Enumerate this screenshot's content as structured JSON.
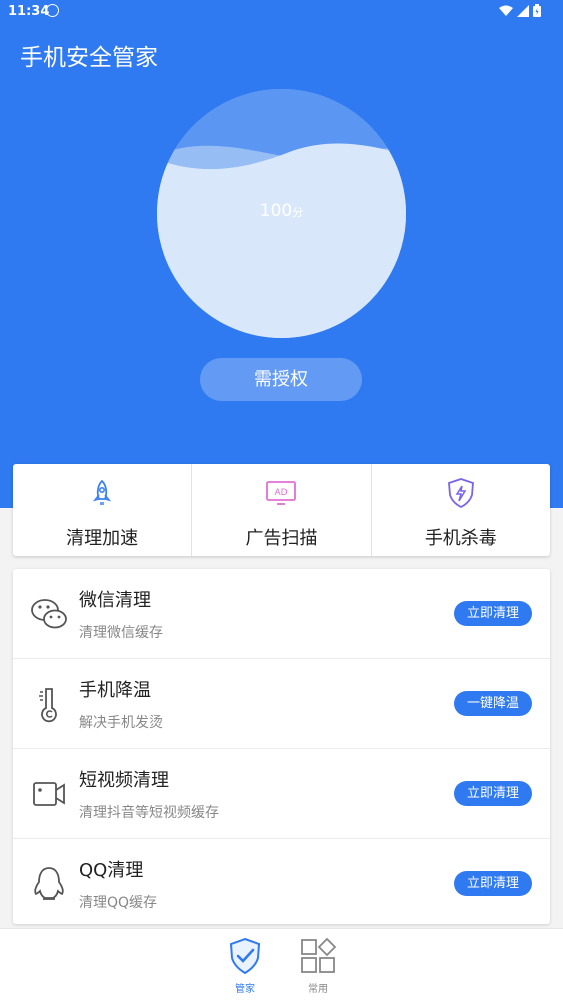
{
  "status": {
    "time": "11:34"
  },
  "app": {
    "title": "手机安全管家"
  },
  "score": {
    "value": "100",
    "unit": "分"
  },
  "auth_button": "需授权",
  "quick_actions": [
    {
      "label": "清理加速",
      "icon": "rocket-icon"
    },
    {
      "label": "广告扫描",
      "icon": "ad-monitor-icon"
    },
    {
      "label": "手机杀毒",
      "icon": "shield-bolt-icon"
    }
  ],
  "tools": [
    {
      "title": "微信清理",
      "subtitle": "清理微信缓存",
      "button": "立即清理",
      "icon": "wechat-icon"
    },
    {
      "title": "手机降温",
      "subtitle": "解决手机发烫",
      "button": "一键降温",
      "icon": "thermometer-icon"
    },
    {
      "title": "短视频清理",
      "subtitle": "清理抖音等短视频缓存",
      "button": "立即清理",
      "icon": "video-camera-icon"
    },
    {
      "title": "QQ清理",
      "subtitle": "清理QQ缓存",
      "button": "立即清理",
      "icon": "qq-penguin-icon"
    }
  ],
  "nav": [
    {
      "label": "管家",
      "icon": "shield-check-icon",
      "active": true
    },
    {
      "label": "常用",
      "icon": "apps-grid-icon",
      "active": false
    }
  ],
  "colors": {
    "primary": "#2f7af0",
    "background": "#f3f3f3"
  }
}
